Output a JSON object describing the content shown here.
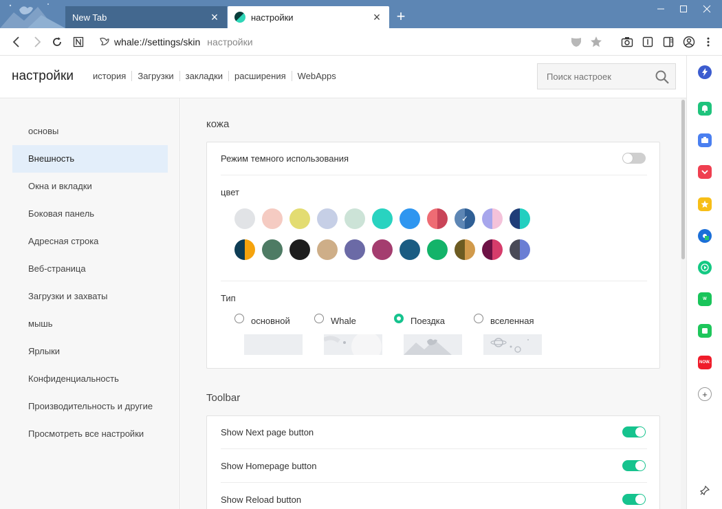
{
  "tabs": [
    {
      "title": "New Tab"
    },
    {
      "title": "настройки"
    }
  ],
  "address": {
    "url": "whale://settings/skin",
    "page_title": "настройки"
  },
  "header": {
    "title": "настройки",
    "nav": [
      "история",
      "Загрузки",
      "закладки",
      "расширения",
      "WebApps"
    ],
    "search_placeholder": "Поиск настроек"
  },
  "sidebar": {
    "items": [
      {
        "label": "основы"
      },
      {
        "label": "Внешность"
      },
      {
        "label": "Окна и вкладки"
      },
      {
        "label": "Боковая панель"
      },
      {
        "label": "Адресная строка"
      },
      {
        "label": "Веб-страница"
      },
      {
        "label": "Загрузки и захваты"
      },
      {
        "label": "мышь"
      },
      {
        "label": "Ярлыки"
      },
      {
        "label": "Конфиденциальность"
      },
      {
        "label": "Производительность и другие"
      },
      {
        "label": "Просмотреть все настройки"
      }
    ],
    "active_index": 1
  },
  "skin": {
    "section_title": "кожа",
    "dark_mode_label": "Режим темного использования",
    "dark_mode_on": false,
    "color_label": "цвет",
    "colors_row1": [
      [
        "#e1e3e6",
        "#e1e3e6"
      ],
      [
        "#f5cbc2",
        "#f5cbc2"
      ],
      [
        "#e3dc71",
        "#e3dc71"
      ],
      [
        "#c6cfe6",
        "#c6cfe6"
      ],
      [
        "#cce3d7",
        "#cce3d7"
      ],
      [
        "#29d3c0",
        "#29d3c0"
      ],
      [
        "#2f96f0",
        "#2f96f0"
      ],
      [
        "#ee6c74",
        "#c94458"
      ],
      [
        "#5d86b4",
        "#2f5f95"
      ],
      [
        "#a7a6ec",
        "#f4c2da"
      ],
      [
        "#1f3d78",
        "#22cfc0"
      ]
    ],
    "colors_row2": [
      [
        "#0e3d55",
        "#f5a30d"
      ],
      [
        "#4e7b64",
        "#4e7b64"
      ],
      [
        "#1d1d1d",
        "#1d1d1d"
      ],
      [
        "#ceae88",
        "#ceae88"
      ],
      [
        "#6b6aa6",
        "#6b6aa6"
      ],
      [
        "#a43d6f",
        "#a43d6f"
      ],
      [
        "#1a5c82",
        "#1a5c82"
      ],
      [
        "#13b369",
        "#13b369"
      ],
      [
        "#6d5c22",
        "#d19a4b"
      ],
      [
        "#6d1245",
        "#d63c6b"
      ],
      [
        "#494a57",
        "#6a7ed4"
      ]
    ],
    "selected_color_index": 8,
    "type_label": "Тип",
    "types": [
      "основной",
      "Whale",
      "Поездка",
      "вселенная"
    ],
    "selected_type_index": 2,
    "check_symbol": "✓"
  },
  "toolbar": {
    "section_title": "Toolbar",
    "options": [
      {
        "label": "Show Next page button",
        "on": true
      },
      {
        "label": "Show Homepage button",
        "on": true
      },
      {
        "label": "Show Reload button",
        "on": true
      }
    ]
  },
  "icons": {
    "accent": "#16c38e",
    "titlebar": "#5d86b4"
  }
}
